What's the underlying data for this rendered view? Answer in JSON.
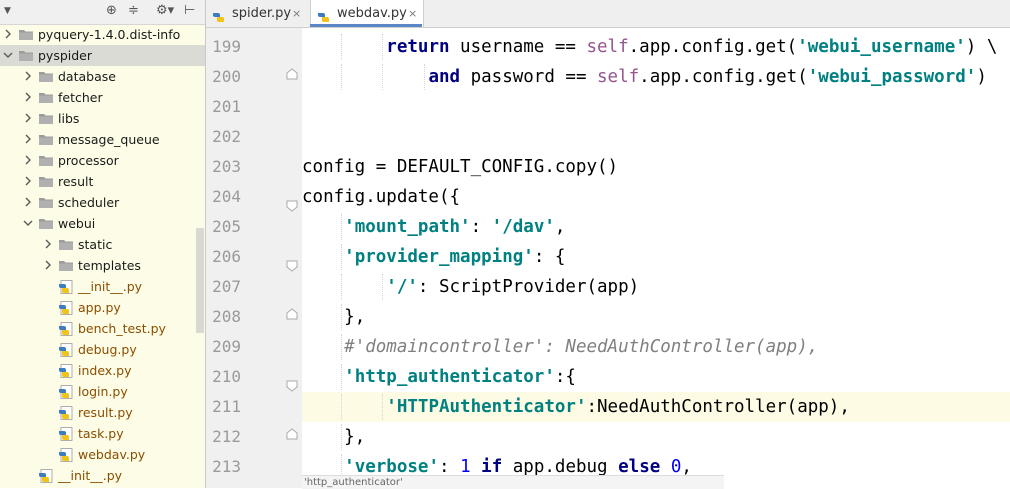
{
  "tree": {
    "items": [
      {
        "label": "pyquery-1.4.0.dist-info",
        "kind": "folder",
        "depth": 0,
        "arrow": "right",
        "icon": "folder-icon"
      },
      {
        "label": "pyspider",
        "kind": "folder",
        "depth": 0,
        "arrow": "down",
        "icon": "folder-icon"
      },
      {
        "label": "database",
        "kind": "folder",
        "depth": 1,
        "arrow": "right",
        "icon": "folder-icon"
      },
      {
        "label": "fetcher",
        "kind": "folder",
        "depth": 1,
        "arrow": "right",
        "icon": "folder-icon"
      },
      {
        "label": "libs",
        "kind": "folder",
        "depth": 1,
        "arrow": "right",
        "icon": "folder-icon"
      },
      {
        "label": "message_queue",
        "kind": "folder",
        "depth": 1,
        "arrow": "right",
        "icon": "folder-icon"
      },
      {
        "label": "processor",
        "kind": "folder",
        "depth": 1,
        "arrow": "right",
        "icon": "folder-icon"
      },
      {
        "label": "result",
        "kind": "folder",
        "depth": 1,
        "arrow": "right",
        "icon": "folder-icon"
      },
      {
        "label": "scheduler",
        "kind": "folder",
        "depth": 1,
        "arrow": "right",
        "icon": "folder-icon"
      },
      {
        "label": "webui",
        "kind": "folder",
        "depth": 1,
        "arrow": "down",
        "icon": "folder-icon"
      },
      {
        "label": "static",
        "kind": "folder",
        "depth": 2,
        "arrow": "right",
        "icon": "folder-icon"
      },
      {
        "label": "templates",
        "kind": "folder",
        "depth": 2,
        "arrow": "right",
        "icon": "folder-icon"
      },
      {
        "label": "__init__.py",
        "kind": "file",
        "depth": 2,
        "arrow": "",
        "icon": "python-file-icon"
      },
      {
        "label": "app.py",
        "kind": "file",
        "depth": 2,
        "arrow": "",
        "icon": "python-file-icon"
      },
      {
        "label": "bench_test.py",
        "kind": "file",
        "depth": 2,
        "arrow": "",
        "icon": "python-file-icon"
      },
      {
        "label": "debug.py",
        "kind": "file",
        "depth": 2,
        "arrow": "",
        "icon": "python-file-icon"
      },
      {
        "label": "index.py",
        "kind": "file",
        "depth": 2,
        "arrow": "",
        "icon": "python-file-icon"
      },
      {
        "label": "login.py",
        "kind": "file",
        "depth": 2,
        "arrow": "",
        "icon": "python-file-icon"
      },
      {
        "label": "result.py",
        "kind": "file",
        "depth": 2,
        "arrow": "",
        "icon": "python-file-icon"
      },
      {
        "label": "task.py",
        "kind": "file",
        "depth": 2,
        "arrow": "",
        "icon": "python-file-icon"
      },
      {
        "label": "webdav.py",
        "kind": "file",
        "depth": 2,
        "arrow": "",
        "icon": "python-file-icon"
      },
      {
        "label": "__init__.py",
        "kind": "file",
        "depth": 1,
        "arrow": "",
        "icon": "python-file-icon"
      }
    ],
    "selected_label": "pyspider",
    "toolbar_icons": [
      "dropdown-icon",
      "crosshair-icon",
      "collapse-icon",
      "gear-icon",
      "hide-icon"
    ]
  },
  "tabs": [
    {
      "label": "spider.py",
      "close": "×",
      "active": false,
      "icon": "python-file-icon"
    },
    {
      "label": "webdav.py",
      "close": "×",
      "active": true,
      "icon": "python-file-icon"
    }
  ],
  "editor": {
    "current_line": "211",
    "lines": [
      {
        "num": "199",
        "fold": "",
        "indent": 2,
        "tokens": [
          [
            "kw",
            "return"
          ],
          [
            "p",
            " username == "
          ],
          [
            "slf",
            "self"
          ],
          [
            "p",
            ".app.config.get("
          ],
          [
            "str",
            "'webui_username'"
          ],
          [
            "p",
            ") \\"
          ]
        ]
      },
      {
        "num": "200",
        "fold": "end",
        "indent": 3,
        "tokens": [
          [
            "kw",
            "and"
          ],
          [
            "p",
            " password == "
          ],
          [
            "slf",
            "self"
          ],
          [
            "p",
            ".app.config.get("
          ],
          [
            "str",
            "'webui_password'"
          ],
          [
            "p",
            ")"
          ]
        ]
      },
      {
        "num": "201",
        "fold": "",
        "indent": 0,
        "tokens": []
      },
      {
        "num": "202",
        "fold": "",
        "indent": 0,
        "tokens": []
      },
      {
        "num": "203",
        "fold": "",
        "indent": 0,
        "tokens": [
          [
            "p",
            "config = DEFAULT_CONFIG.copy()"
          ]
        ]
      },
      {
        "num": "204",
        "fold": "start",
        "indent": 0,
        "tokens": [
          [
            "p",
            "config.update({"
          ]
        ]
      },
      {
        "num": "205",
        "fold": "",
        "indent": 1,
        "tokens": [
          [
            "str",
            "'mount_path'"
          ],
          [
            "p",
            ": "
          ],
          [
            "str",
            "'/dav'"
          ],
          [
            "p",
            ","
          ]
        ]
      },
      {
        "num": "206",
        "fold": "start",
        "indent": 1,
        "tokens": [
          [
            "str",
            "'provider_mapping'"
          ],
          [
            "p",
            ": {"
          ]
        ]
      },
      {
        "num": "207",
        "fold": "",
        "indent": 2,
        "tokens": [
          [
            "str",
            "'/'"
          ],
          [
            "p",
            ": ScriptProvider(app)"
          ]
        ]
      },
      {
        "num": "208",
        "fold": "end",
        "indent": 1,
        "tokens": [
          [
            "p",
            "},"
          ]
        ]
      },
      {
        "num": "209",
        "fold": "",
        "indent": 1,
        "tokens": [
          [
            "cmt",
            "#'domaincontroller': NeedAuthController(app),"
          ]
        ]
      },
      {
        "num": "210",
        "fold": "start",
        "indent": 1,
        "tokens": [
          [
            "str",
            "'http_authenticator'"
          ],
          [
            "p",
            ":{"
          ]
        ]
      },
      {
        "num": "211",
        "fold": "",
        "indent": 2,
        "tokens": [
          [
            "str",
            "'HTTPAuthenticator'"
          ],
          [
            "p",
            ":NeedAuthController(app),"
          ]
        ]
      },
      {
        "num": "212",
        "fold": "end",
        "indent": 1,
        "tokens": [
          [
            "p",
            "},"
          ]
        ]
      },
      {
        "num": "213",
        "fold": "",
        "indent": 1,
        "tokens": [
          [
            "str",
            "'verbose'"
          ],
          [
            "p",
            ": "
          ],
          [
            "num",
            "1"
          ],
          [
            "p",
            " "
          ],
          [
            "kw",
            "if"
          ],
          [
            "p",
            " app.debug "
          ],
          [
            "kw",
            "else"
          ],
          [
            "p",
            " "
          ],
          [
            "num",
            "0"
          ],
          [
            "p",
            ","
          ]
        ]
      }
    ]
  },
  "breadcrumb": "'http_authenticator'",
  "colors": {
    "keyword": "#000080",
    "string": "#008080",
    "self": "#94558d",
    "number": "#0000ff",
    "comment": "#808080",
    "folder": "#9b9b9b",
    "python_blue": "#3e7cc0",
    "python_yellow": "#f0c419"
  }
}
